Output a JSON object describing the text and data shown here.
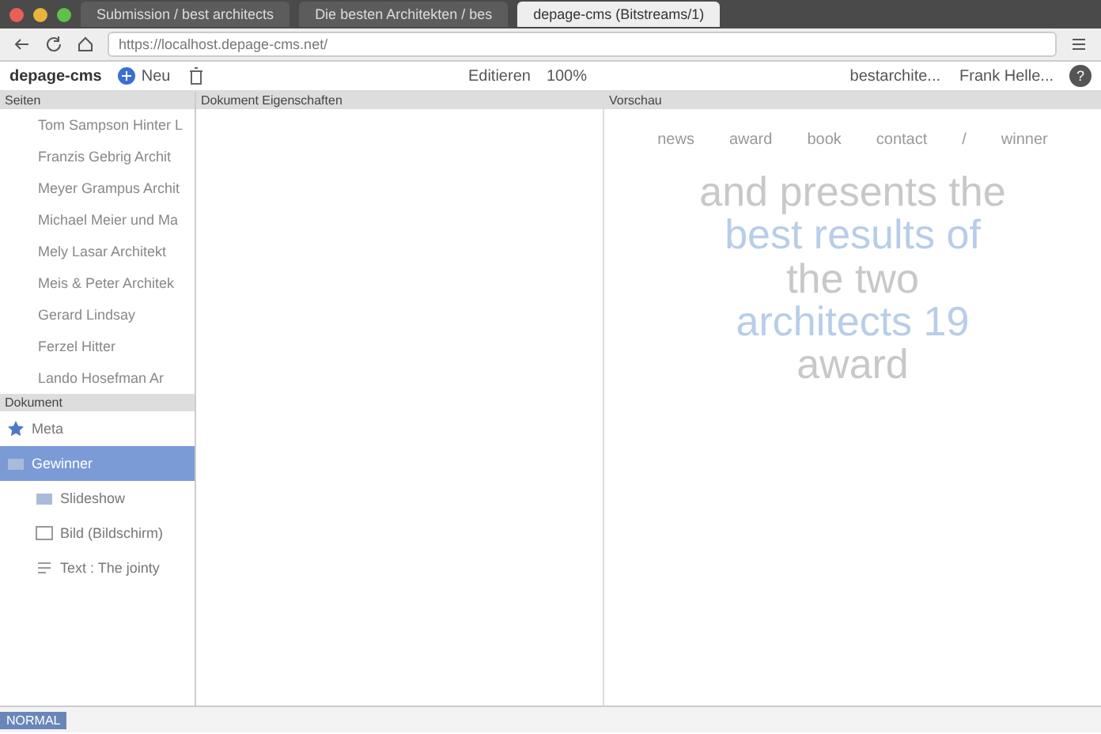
{
  "browser": {
    "tabs": [
      {
        "title": "Submission / best architects",
        "selected": false
      },
      {
        "title": "Die besten Architekten / bes",
        "selected": false
      },
      {
        "title": "depage-cms (Bitstreams/1)",
        "selected": true
      }
    ],
    "url": "https://localhost.depage-cms.net/"
  },
  "toolbar": {
    "logo": "depage-cms",
    "new_label": "Neu",
    "edit_label": "Editieren",
    "zoom": "100%",
    "project": "bestarchite...",
    "user": "Frank Helle...",
    "help": "?"
  },
  "pages": {
    "title": "Seiten",
    "items": [
      {
        "label": "Tom Sampson Hinter L",
        "selected": false
      },
      {
        "label": "Franzis Gebrig Archit",
        "selected": false
      },
      {
        "label": "Meyer Grampus Archit",
        "selected": false
      },
      {
        "label": "Michael Meier und Ma",
        "selected": false
      },
      {
        "label": "Mely Lasar Architekt",
        "selected": false
      },
      {
        "label": "Meis & Peter Architek",
        "selected": false
      },
      {
        "label": "Gerard Lindsay",
        "selected": false
      },
      {
        "label": "Ferzel Hitter",
        "selected": false
      },
      {
        "label": "Lando Hosefman Ar",
        "selected": false
      }
    ]
  },
  "document": {
    "title": "Dokument",
    "items": [
      {
        "label": "Meta",
        "kind": "meta",
        "selected": false
      },
      {
        "label": "Gewinner",
        "kind": "section",
        "selected": true,
        "children": [
          {
            "label": "Slideshow",
            "kind": "section",
            "selected": false
          },
          {
            "label": "Bild (Bildschirm)",
            "kind": "image",
            "selected": false
          },
          {
            "label": "Text : The jointy",
            "kind": "text",
            "selected": false
          }
        ]
      }
    ]
  },
  "properties": {
    "title": "Dokument Eigenschaften"
  },
  "preview": {
    "title": "Vorschau",
    "nav": [
      "news",
      "award",
      "book",
      "contact",
      "/",
      "winner"
    ],
    "headline": [
      "and presents the",
      "best results of",
      "the two",
      "architects 19",
      "award"
    ]
  },
  "status_bar": {
    "mode": "NORMAL"
  }
}
